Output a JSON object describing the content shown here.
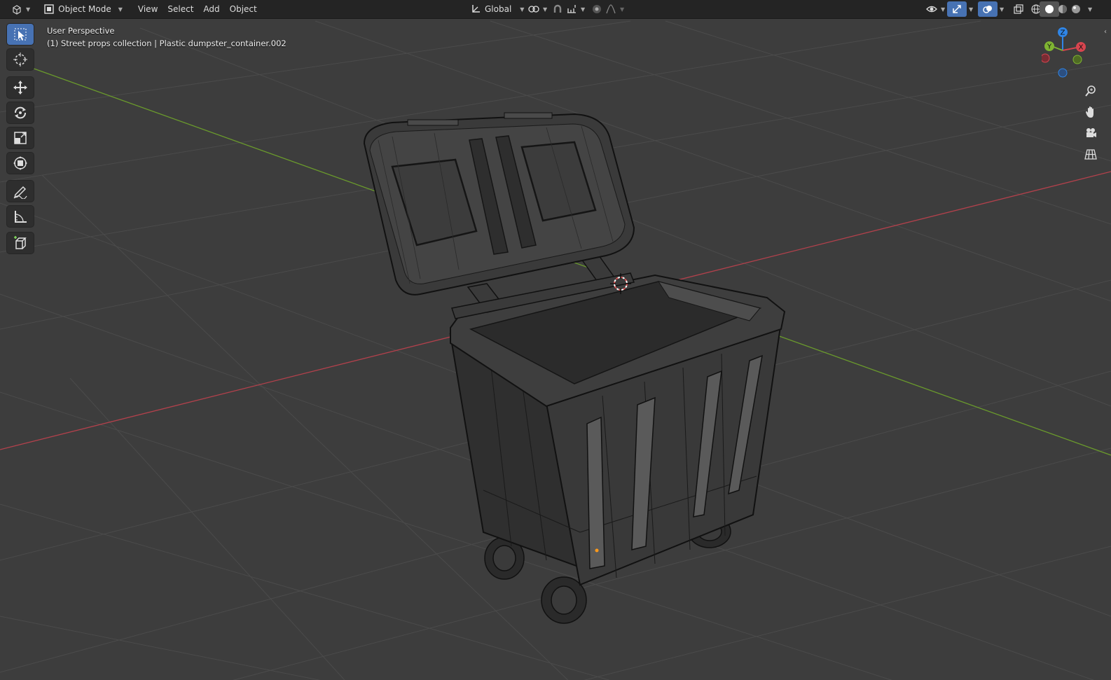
{
  "header": {
    "editor_type_icon": "view3d-icon",
    "mode": {
      "icon": "object-mode-icon",
      "label": "Object Mode"
    },
    "menus": [
      "View",
      "Select",
      "Add",
      "Object"
    ],
    "transform_orientation": {
      "icon": "orientation-icon",
      "label": "Global"
    },
    "pivot_icon": "pivot-point-icon",
    "snap_icon": "snap-magnet-icon",
    "snap_target_icon": "snap-increment-icon",
    "proportional_icon": "proportional-editing-icon",
    "falloff_icon": "falloff-curve-icon",
    "right_icons": [
      "visibility-icon",
      "gizmo-icon",
      "overlay-icon",
      "xray-icon",
      "wireframe-shading-icon",
      "solid-shading-icon",
      "material-shading-icon",
      "rendered-shading-icon"
    ]
  },
  "viewport": {
    "view_name": "User Perspective",
    "object_info": "(1) Street props collection | Plastic dumpster_container.002"
  },
  "toolbar": {
    "tools": [
      {
        "name": "select-box-tool",
        "icon": "select-box-icon",
        "active": true
      },
      {
        "name": "cursor-tool",
        "icon": "cursor-icon",
        "active": false
      },
      {
        "name": "move-tool",
        "icon": "move-icon",
        "active": false
      },
      {
        "name": "rotate-tool",
        "icon": "rotate-icon",
        "active": false
      },
      {
        "name": "scale-tool",
        "icon": "scale-icon",
        "active": false
      },
      {
        "name": "transform-tool",
        "icon": "transform-icon",
        "active": false
      },
      {
        "name": "annotate-tool",
        "icon": "annotate-icon",
        "active": false
      },
      {
        "name": "measure-tool",
        "icon": "measure-icon",
        "active": false
      },
      {
        "name": "add-cube-tool",
        "icon": "add-cube-icon",
        "active": false
      }
    ]
  },
  "gizmo": {
    "x_label": "X",
    "y_label": "Y",
    "z_label": "Z"
  },
  "nav_buttons": [
    "zoom-icon",
    "pan-hand-icon",
    "camera-icon",
    "ortho-grid-icon"
  ],
  "colors": {
    "background": "#3d3d3d",
    "grid_line": "#4d4d4d",
    "x_axis": "#b3414c",
    "y_axis": "#6a9a2c",
    "z_axis": "#2f85e6",
    "active_tool": "#4772b3",
    "wire": "#141414"
  }
}
